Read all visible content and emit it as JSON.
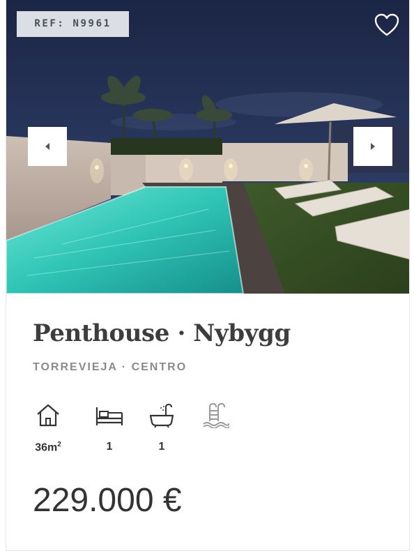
{
  "listing": {
    "ref": "REF: N9961",
    "title": "Penthouse · Nybygg",
    "location": "TORREVIEJA · CENTRO",
    "price": "229.000 €"
  },
  "features": {
    "area_value": "36m",
    "area_unit_sup": "2",
    "bedrooms": "1",
    "bathrooms": "1"
  },
  "icons": {
    "favorite": "heart-icon",
    "prev": "chevron-left-icon",
    "next": "chevron-right-icon",
    "area": "house-icon",
    "bedrooms": "bed-icon",
    "bathrooms": "bathtub-icon",
    "pool": "pool-ladder-icon"
  },
  "colors": {
    "pool_water": "#3fd0c0",
    "night_sky": "#1e2a48",
    "text_dark": "#333333",
    "text_muted": "#8a8a8a"
  }
}
